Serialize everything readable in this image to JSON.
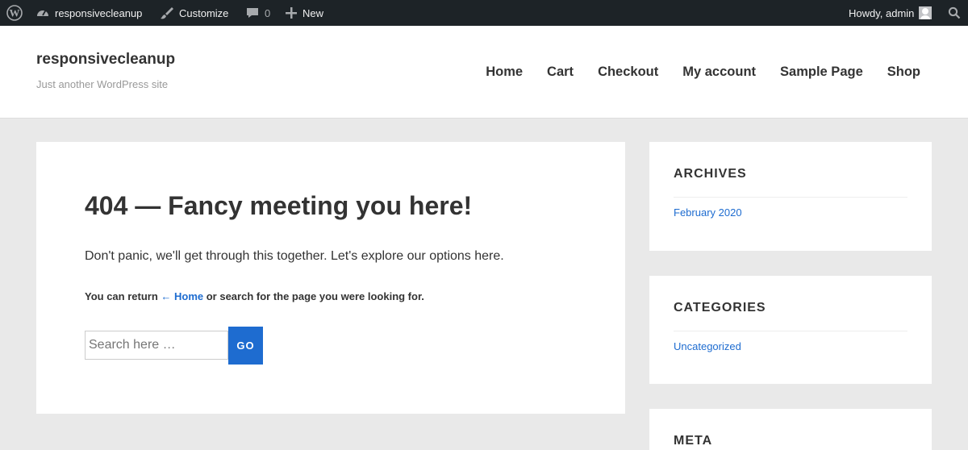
{
  "admin_bar": {
    "site_name": "responsivecleanup",
    "customize": "Customize",
    "comments_count": "0",
    "new": "New",
    "greeting": "Howdy, admin"
  },
  "site": {
    "title": "responsivecleanup",
    "tagline": "Just another WordPress site"
  },
  "nav": [
    "Home",
    "Cart",
    "Checkout",
    "My account",
    "Sample Page",
    "Shop"
  ],
  "main": {
    "heading": "404 — Fancy meeting you here!",
    "intro": "Don't panic, we'll get through this together. Let's explore our options here.",
    "return_prefix": "You can return ",
    "return_link": "← Home",
    "return_suffix": " or search for the page you were looking for.",
    "search_placeholder": "Search here …",
    "go_label": "GO"
  },
  "widgets": {
    "archives": {
      "title": "ARCHIVES",
      "items": [
        "February 2020"
      ]
    },
    "categories": {
      "title": "CATEGORIES",
      "items": [
        "Uncategorized"
      ]
    },
    "meta": {
      "title": "META"
    }
  },
  "colors": {
    "admin_bar_bg": "#1d2327",
    "link": "#1e6cd0",
    "page_bg": "#e9e9e9"
  }
}
